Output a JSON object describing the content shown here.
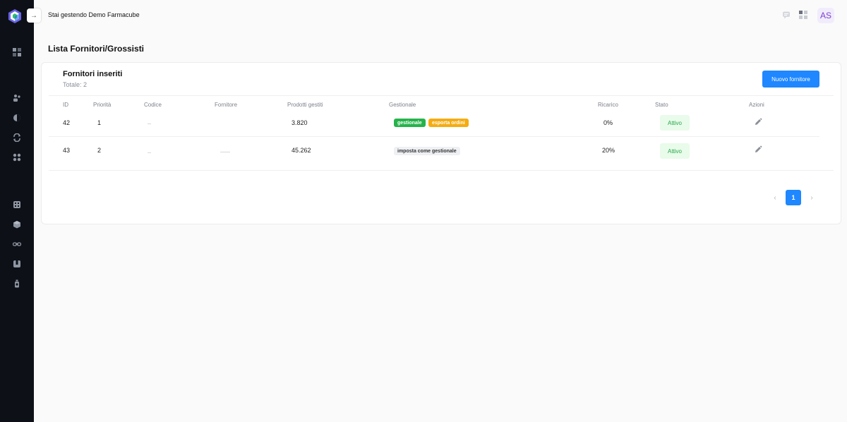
{
  "app": {
    "manage_text": "Stai gestendo Demo Farmacube",
    "avatar": "AS",
    "collapse_arrow": "→"
  },
  "sidebar": {
    "icons": [
      "dashboard-icon",
      "users-icon",
      "contrast-icon",
      "refresh-icon",
      "apps-icon",
      "calculator-icon",
      "box-icon",
      "link-icon",
      "package-icon",
      "bottle-icon"
    ]
  },
  "page": {
    "title": "Lista Fornitori/Grossisti"
  },
  "card": {
    "title": "Fornitori inseriti",
    "subtitle": "Totale: 2",
    "new_button": "Nuovo fornitore"
  },
  "table": {
    "columns": [
      "ID",
      "Priorità",
      "Codice",
      "Fornitore",
      "Prodotti gestiti",
      "Gestionale",
      "Ricarico",
      "Stato",
      "Azioni"
    ],
    "rows": [
      {
        "id": "42",
        "priorita": "1",
        "prodotti": "3.820",
        "tags": [
          "gestionale",
          "esporta ordini"
        ],
        "ricarico": "0%",
        "stato": "Attivo"
      },
      {
        "id": "43",
        "priorita": "2",
        "prodotti": "45.262",
        "tags": [
          "imposta come gestionale"
        ],
        "ricarico": "20%",
        "stato": "Attivo"
      }
    ]
  },
  "pagination": {
    "prev": "‹",
    "current": "1",
    "next": "›"
  },
  "colors": {
    "accent": "#1f87ff",
    "sidebar": "#0d1117",
    "status_green": "#25a64b",
    "tag_green": "#25b34a",
    "tag_orange": "#f4ac12"
  }
}
